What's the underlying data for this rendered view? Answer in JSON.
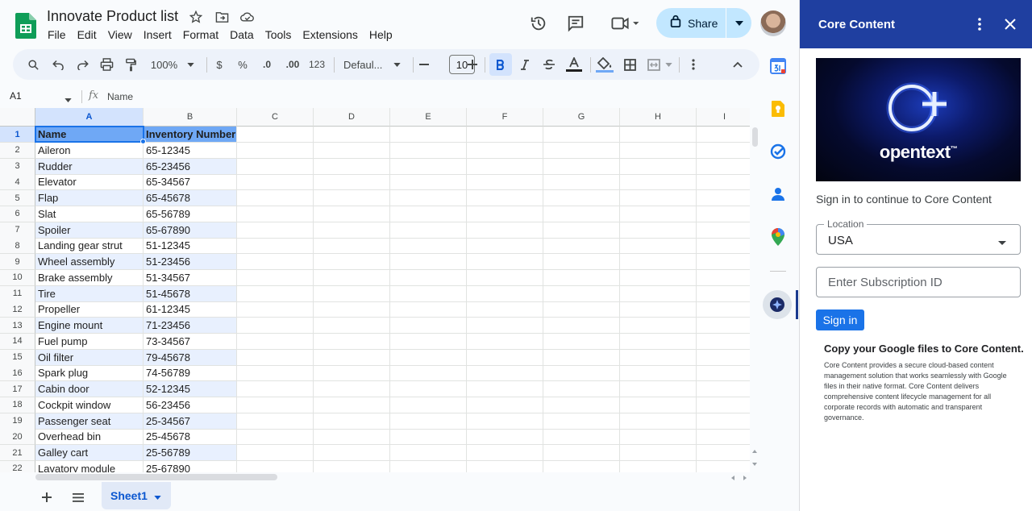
{
  "app": {
    "doc_title": "Innovate Product list",
    "menu": [
      "File",
      "Edit",
      "View",
      "Insert",
      "Format",
      "Data",
      "Tools",
      "Extensions",
      "Help"
    ],
    "share_label": "Share"
  },
  "toolbar": {
    "zoom": "100%",
    "currency": "$",
    "percent": "%",
    "dec_decrease": ".0",
    "dec_increase": ".00",
    "number_format": "123",
    "font": "Defaul...",
    "font_size": "10"
  },
  "formula_bar": {
    "cell_ref": "A1",
    "fx": "fx",
    "value": "Name"
  },
  "grid": {
    "columns": [
      "A",
      "B",
      "C",
      "D",
      "E",
      "F",
      "G",
      "H",
      "I"
    ],
    "rows": [
      {
        "n": "1",
        "a": "Name",
        "b": "Inventory Number"
      },
      {
        "n": "2",
        "a": "Aileron",
        "b": "65-12345"
      },
      {
        "n": "3",
        "a": "Rudder",
        "b": "65-23456"
      },
      {
        "n": "4",
        "a": "Elevator",
        "b": "65-34567"
      },
      {
        "n": "5",
        "a": "Flap",
        "b": "65-45678"
      },
      {
        "n": "6",
        "a": "Slat",
        "b": "65-56789"
      },
      {
        "n": "7",
        "a": "Spoiler",
        "b": "65-67890"
      },
      {
        "n": "8",
        "a": "Landing gear strut",
        "b": "51-12345"
      },
      {
        "n": "9",
        "a": "Wheel assembly",
        "b": "51-23456"
      },
      {
        "n": "10",
        "a": "Brake assembly",
        "b": "51-34567"
      },
      {
        "n": "11",
        "a": "Tire",
        "b": "51-45678"
      },
      {
        "n": "12",
        "a": "Propeller",
        "b": "61-12345"
      },
      {
        "n": "13",
        "a": "Engine mount",
        "b": "71-23456"
      },
      {
        "n": "14",
        "a": "Fuel pump",
        "b": "73-34567"
      },
      {
        "n": "15",
        "a": "Oil filter",
        "b": "79-45678"
      },
      {
        "n": "16",
        "a": "Spark plug",
        "b": "74-56789"
      },
      {
        "n": "17",
        "a": "Cabin door",
        "b": "52-12345"
      },
      {
        "n": "18",
        "a": "Cockpit window",
        "b": "56-23456"
      },
      {
        "n": "19",
        "a": "Passenger seat",
        "b": "25-34567"
      },
      {
        "n": "20",
        "a": "Overhead bin",
        "b": "25-45678"
      },
      {
        "n": "21",
        "a": "Galley cart",
        "b": "25-56789"
      },
      {
        "n": "22",
        "a": "Lavatory module",
        "b": "25-67890"
      }
    ]
  },
  "sheets": {
    "active": "Sheet1"
  },
  "panel": {
    "title": "Core Content",
    "brand": "opentext",
    "brand_tm": "™",
    "signin_prompt": "Sign in to continue to Core Content",
    "location_label": "Location",
    "location_value": "USA",
    "subscription_placeholder": "Enter Subscription ID",
    "signin_button": "Sign in",
    "copy_title": "Copy your Google files to Core Content.",
    "copy_desc": "Core Content provides a secure cloud-based content management solution that works seamlessly with Google files in their native format. Core Content delivers comprehensive content lifecycle management for all corporate records with automatic and transparent governance."
  },
  "colors": {
    "header_band": "#6fa8f5",
    "row_band": "#e8f0fe",
    "panel_header": "#1f3fa0",
    "accent": "#1a73e8",
    "share_bg": "#c2e7ff"
  }
}
